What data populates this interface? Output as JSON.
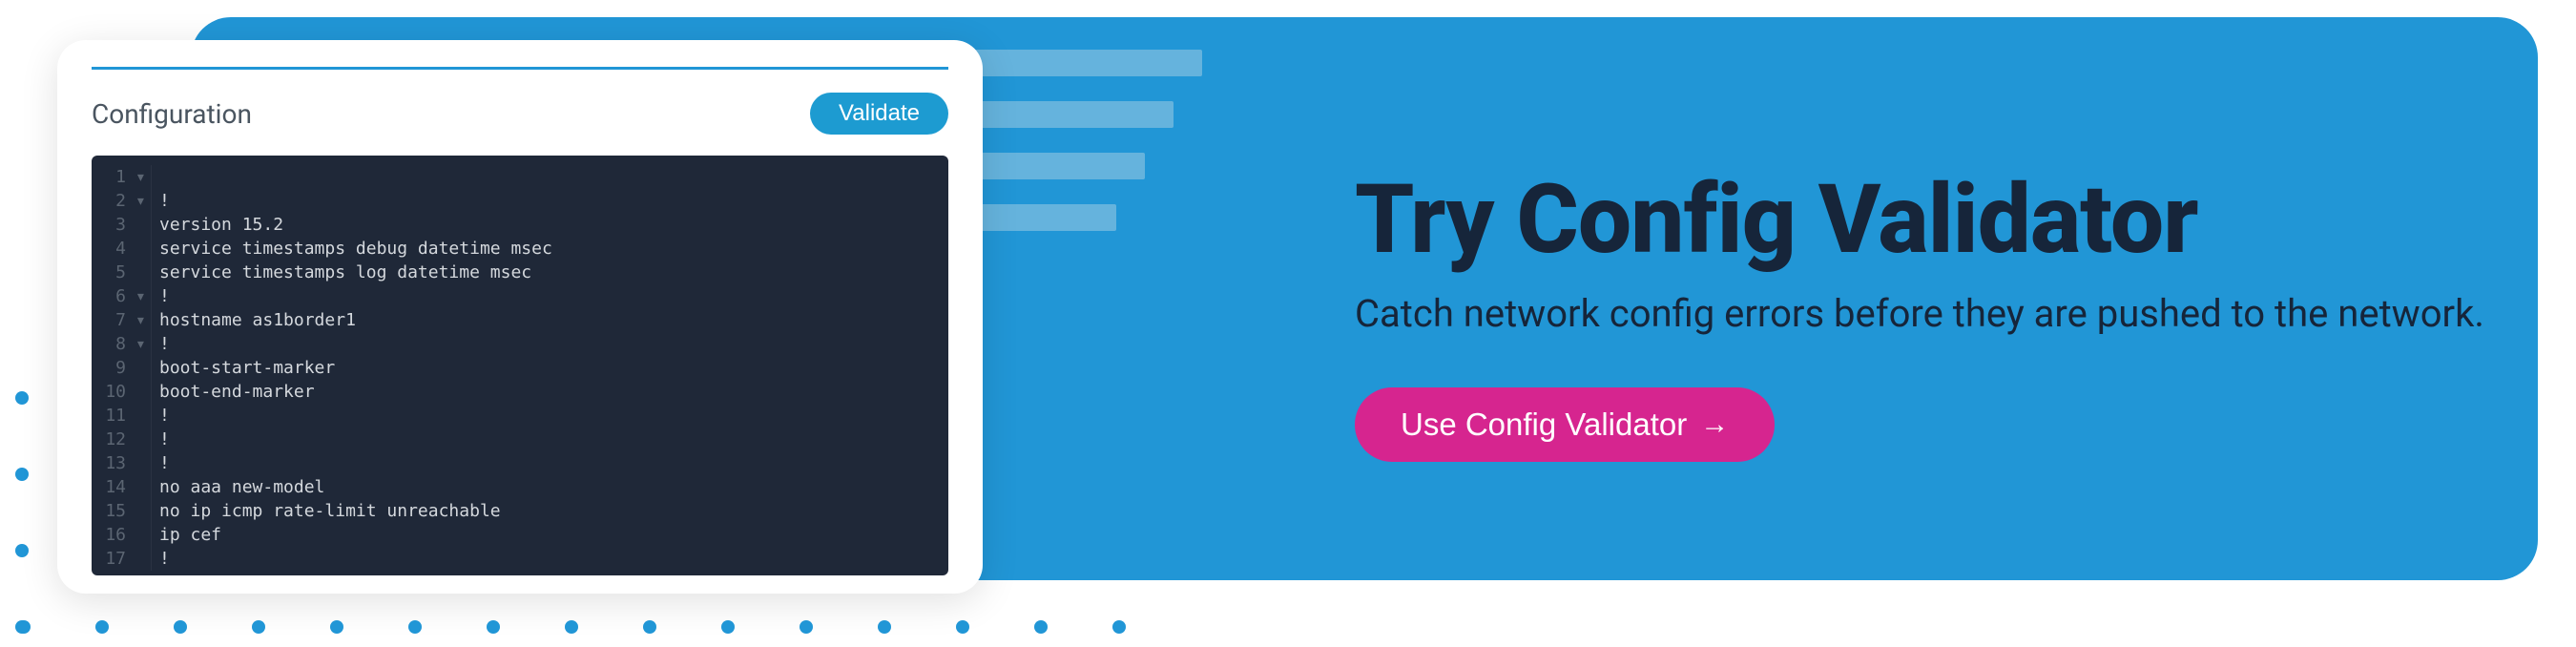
{
  "headline": "Try Config Validator",
  "subhead": "Catch network config errors before they are pushed to the network.",
  "cta_label": "Use Config Validator",
  "cta_arrow": "→",
  "card": {
    "title": "Configuration",
    "validate_label": "Validate",
    "lines": [
      {
        "n": "1",
        "fold": "▾",
        "text": ""
      },
      {
        "n": "2",
        "fold": "▾",
        "text": "!"
      },
      {
        "n": "3",
        "fold": "",
        "text": "version 15.2"
      },
      {
        "n": "4",
        "fold": "",
        "text": "service timestamps debug datetime msec"
      },
      {
        "n": "5",
        "fold": "",
        "text": "service timestamps log datetime msec"
      },
      {
        "n": "6",
        "fold": "▾",
        "text": "!"
      },
      {
        "n": "7",
        "fold": "▾",
        "text": "hostname as1border1"
      },
      {
        "n": "8",
        "fold": "▾",
        "text": "!"
      },
      {
        "n": "9",
        "fold": "",
        "text": "boot-start-marker"
      },
      {
        "n": "10",
        "fold": "",
        "text": "boot-end-marker"
      },
      {
        "n": "11",
        "fold": "",
        "text": "!"
      },
      {
        "n": "12",
        "fold": "",
        "text": "!"
      },
      {
        "n": "13",
        "fold": "",
        "text": "!"
      },
      {
        "n": "14",
        "fold": "",
        "text": "no aaa new-model"
      },
      {
        "n": "15",
        "fold": "",
        "text": "no ip icmp rate-limit unreachable"
      },
      {
        "n": "16",
        "fold": "",
        "text": "ip cef"
      },
      {
        "n": "17",
        "fold": "",
        "text": "!"
      }
    ]
  }
}
